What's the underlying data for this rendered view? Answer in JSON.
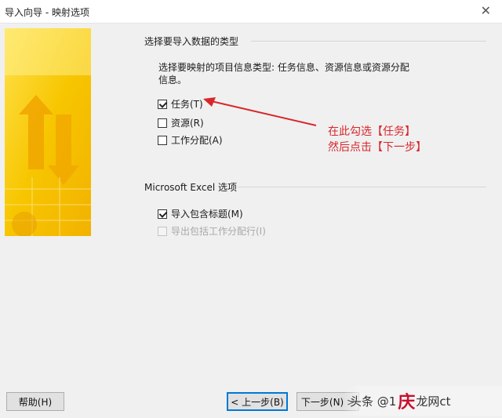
{
  "window": {
    "title": "导入向导 - 映射选项"
  },
  "section1": {
    "heading": "选择要导入数据的类型",
    "description": "选择要映射的项目信息类型: 任务信息、资源信息或资源分配信息。",
    "options": [
      {
        "label": "任务(T)",
        "checked": true,
        "disabled": false
      },
      {
        "label": "资源(R)",
        "checked": false,
        "disabled": false
      },
      {
        "label": "工作分配(A)",
        "checked": false,
        "disabled": false
      }
    ]
  },
  "annotation": {
    "line1": "在此勾选【任务】",
    "line2": "然后点击【下一步】",
    "color": "#d9262a"
  },
  "section2": {
    "heading": "Microsoft Excel 选项",
    "options": [
      {
        "label": "导入包含标题(M)",
        "checked": true,
        "disabled": false
      },
      {
        "label": "导出包括工作分配行(I)",
        "checked": false,
        "disabled": true
      }
    ]
  },
  "buttons": {
    "help": "帮助(H)",
    "back": "< 上一步(B)",
    "next": "下一步(N) >"
  },
  "watermark": {
    "prefix": "头条 @1",
    "brand": "庆",
    "suffix": "龙网ct"
  },
  "colors": {
    "accent": "#0078d7",
    "art_yellow": "#f5c400",
    "art_orange": "#f0a500"
  }
}
